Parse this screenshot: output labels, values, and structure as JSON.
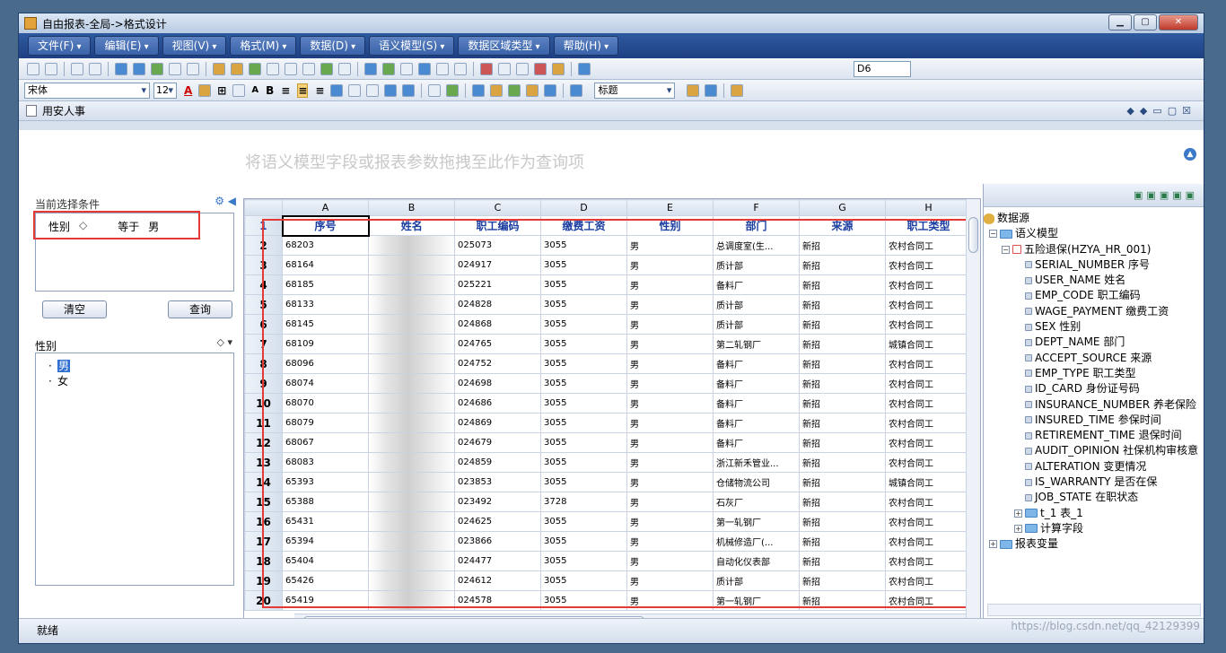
{
  "window": {
    "title": "自由报表-全局->格式设计"
  },
  "menus": [
    "文件(F)",
    "编辑(E)",
    "视图(V)",
    "格式(M)",
    "数据(D)",
    "语义模型(S)",
    "数据区域类型",
    "帮助(H)"
  ],
  "toolbar": {
    "cell_ref": "D6",
    "font_name": "宋体",
    "font_size": "12",
    "style_name": "标题"
  },
  "doc_tab": {
    "title": "用安人事"
  },
  "drop_hint": "将语义模型字段或报表参数拖拽至此作为查询项",
  "conditions": {
    "label": "当前选择条件",
    "rows": [
      {
        "field": "性别",
        "op": "等于",
        "value": "男"
      }
    ],
    "clear_label": "清空",
    "query_label": "查询"
  },
  "field_filter": {
    "label": "性别",
    "options": [
      "男",
      "女"
    ],
    "selected": "男"
  },
  "grid": {
    "columns": [
      "A",
      "B",
      "C",
      "D",
      "E",
      "F",
      "G",
      "H"
    ],
    "headers": [
      "序号",
      "姓名",
      "职工编码",
      "缴费工资",
      "性别",
      "部门",
      "来源",
      "职工类型"
    ],
    "row_numbers": [
      "1",
      "2",
      "3",
      "4",
      "5",
      "6",
      "7",
      "8",
      "9",
      "10",
      "11",
      "12",
      "13",
      "14",
      "15",
      "16",
      "17",
      "18",
      "19",
      "20"
    ],
    "rows": [
      [
        "68203",
        "",
        "025073",
        "3055",
        "男",
        "总调度室(生...",
        "新招",
        "农村合同工"
      ],
      [
        "68164",
        "",
        "024917",
        "3055",
        "男",
        "质计部",
        "新招",
        "农村合同工"
      ],
      [
        "68185",
        "",
        "025221",
        "3055",
        "男",
        "备料厂",
        "新招",
        "农村合同工"
      ],
      [
        "68133",
        "",
        "024828",
        "3055",
        "男",
        "质计部",
        "新招",
        "农村合同工"
      ],
      [
        "68145",
        "",
        "024868",
        "3055",
        "男",
        "质计部",
        "新招",
        "农村合同工"
      ],
      [
        "68109",
        "",
        "024765",
        "3055",
        "男",
        "第二轧钢厂",
        "新招",
        "城镇合同工"
      ],
      [
        "68096",
        "",
        "024752",
        "3055",
        "男",
        "备料厂",
        "新招",
        "农村合同工"
      ],
      [
        "68074",
        "",
        "024698",
        "3055",
        "男",
        "备料厂",
        "新招",
        "农村合同工"
      ],
      [
        "68070",
        "",
        "024686",
        "3055",
        "男",
        "备料厂",
        "新招",
        "农村合同工"
      ],
      [
        "68079",
        "",
        "024869",
        "3055",
        "男",
        "备料厂",
        "新招",
        "农村合同工"
      ],
      [
        "68067",
        "",
        "024679",
        "3055",
        "男",
        "备料厂",
        "新招",
        "农村合同工"
      ],
      [
        "68083",
        "",
        "024859",
        "3055",
        "男",
        "浙江新禾管业...",
        "新招",
        "农村合同工"
      ],
      [
        "65393",
        "",
        "023853",
        "3055",
        "男",
        "仓储物流公司",
        "新招",
        "城镇合同工"
      ],
      [
        "65388",
        "",
        "023492",
        "3728",
        "男",
        "石灰厂",
        "新招",
        "农村合同工"
      ],
      [
        "65431",
        "",
        "024625",
        "3055",
        "男",
        "第一轧钢厂",
        "新招",
        "农村合同工"
      ],
      [
        "65394",
        "",
        "023866",
        "3055",
        "男",
        "机械修造厂(...",
        "新招",
        "农村合同工"
      ],
      [
        "65404",
        "",
        "024477",
        "3055",
        "男",
        "自动化仪表部",
        "新招",
        "农村合同工"
      ],
      [
        "65426",
        "",
        "024612",
        "3055",
        "男",
        "质计部",
        "新招",
        "农村合同工"
      ],
      [
        "65419",
        "",
        "024578",
        "3055",
        "男",
        "第一轧钢厂",
        "新招",
        "农村合同工"
      ]
    ]
  },
  "tree": {
    "root": "数据源",
    "model_folder": "语义模型",
    "table": "五险退保(HZYA_HR_001)",
    "fields": [
      "SERIAL_NUMBER 序号",
      "USER_NAME 姓名",
      "EMP_CODE 职工编码",
      "WAGE_PAYMENT 缴费工资",
      "SEX 性别",
      "DEPT_NAME 部门",
      "ACCEPT_SOURCE 来源",
      "EMP_TYPE 职工类型",
      "ID_CARD 身份证号码",
      "INSURANCE_NUMBER 养老保险",
      "INSURED_TIME 参保时间",
      "RETIREMENT_TIME 退保时间",
      "AUDIT_OPINION 社保机构审核意",
      "ALTERATION 变更情况",
      "IS_WARRANTY 是否在保",
      "JOB_STATE 在职状态"
    ],
    "subfolders": [
      "t_1 表_1",
      "计算字段"
    ],
    "variables": "报表变量"
  },
  "status": {
    "text": "就绪",
    "watermark": "https://blog.csdn.net/qq_42129399"
  }
}
